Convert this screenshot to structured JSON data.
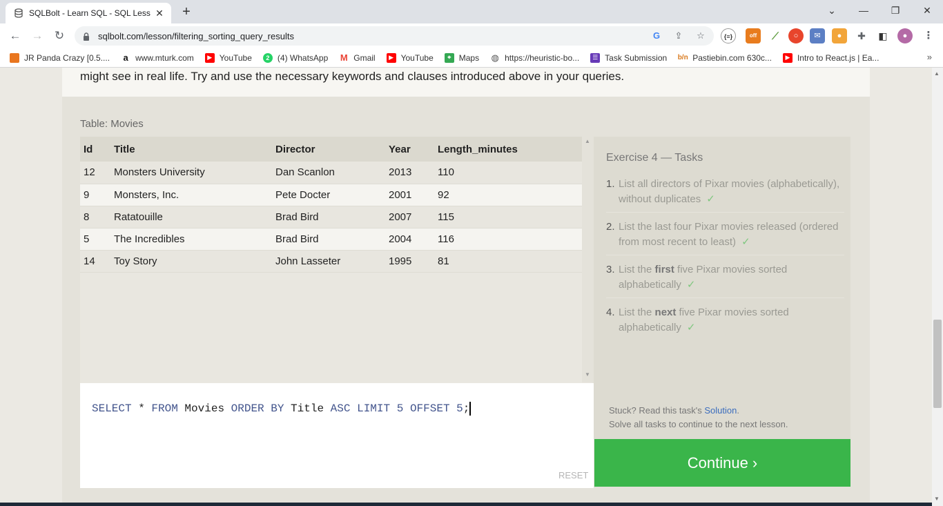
{
  "browser": {
    "tab_title": "SQLBolt - Learn SQL - SQL Lesso",
    "url": "sqlbolt.com/lesson/filtering_sorting_query_results",
    "bookmarks": [
      {
        "label": "JR Panda Crazy [0.5....",
        "icon": "panda-icon",
        "color": "#e9761f"
      },
      {
        "label": "www.mturk.com",
        "icon": "amazon-icon",
        "color": "#111111"
      },
      {
        "label": "YouTube",
        "icon": "youtube-icon",
        "color": "#ff0000"
      },
      {
        "label": "(4) WhatsApp",
        "icon": "whatsapp-icon",
        "color": "#25d366"
      },
      {
        "label": "Gmail",
        "icon": "gmail-icon",
        "color": "#ea4335"
      },
      {
        "label": "YouTube",
        "icon": "youtube-icon",
        "color": "#ff0000"
      },
      {
        "label": "Maps",
        "icon": "maps-icon",
        "color": "#34a853"
      },
      {
        "label": "https://heuristic-bo...",
        "icon": "globe-icon",
        "color": "#555555"
      },
      {
        "label": "Task Submission",
        "icon": "forms-icon",
        "color": "#673ab7"
      },
      {
        "label": "Pastiebin.com 630c...",
        "icon": "pastebin-icon",
        "color": "#d97a1e"
      },
      {
        "label": "Intro to React.js | Ea...",
        "icon": "youtube-icon",
        "color": "#ff0000"
      }
    ],
    "bookmarks_more": "»"
  },
  "page": {
    "intro_text": "might see in real life. Try and use the necessary keywords and clauses introduced above in your queries.",
    "table_caption": "Table: Movies",
    "table": {
      "headers": [
        "Id",
        "Title",
        "Director",
        "Year",
        "Length_minutes"
      ],
      "rows": [
        [
          "12",
          "Monsters University",
          "Dan Scanlon",
          "2013",
          "110"
        ],
        [
          "9",
          "Monsters, Inc.",
          "Pete Docter",
          "2001",
          "92"
        ],
        [
          "8",
          "Ratatouille",
          "Brad Bird",
          "2007",
          "115"
        ],
        [
          "5",
          "The Incredibles",
          "Brad Bird",
          "2004",
          "116"
        ],
        [
          "14",
          "Toy Story",
          "John Lasseter",
          "1995",
          "81"
        ]
      ]
    },
    "editor": {
      "tokens": [
        {
          "t": "SELECT",
          "c": "kw"
        },
        {
          "t": " * ",
          "c": "ident"
        },
        {
          "t": "FROM",
          "c": "kw"
        },
        {
          "t": " Movies ",
          "c": "ident"
        },
        {
          "t": "ORDER BY",
          "c": "kw"
        },
        {
          "t": " Title ",
          "c": "ident"
        },
        {
          "t": "ASC",
          "c": "kw"
        },
        {
          "t": " ",
          "c": "ident"
        },
        {
          "t": "LIMIT",
          "c": "kw"
        },
        {
          "t": " ",
          "c": "ident"
        },
        {
          "t": "5",
          "c": "num"
        },
        {
          "t": " ",
          "c": "ident"
        },
        {
          "t": "OFFSET",
          "c": "kw"
        },
        {
          "t": " ",
          "c": "ident"
        },
        {
          "t": "5",
          "c": "num"
        },
        {
          "t": ";",
          "c": "ident"
        }
      ],
      "reset_label": "RESET"
    },
    "tasks": {
      "title": "Exercise 4 — Tasks",
      "items": [
        {
          "num": "1.",
          "parts": [
            {
              "t": "List all directors of Pixar movies (alphabetically), without duplicates",
              "b": false
            }
          ],
          "check": "✓"
        },
        {
          "num": "2.",
          "parts": [
            {
              "t": "List the last four Pixar movies released (ordered from most recent to least)",
              "b": false
            }
          ],
          "check": "✓"
        },
        {
          "num": "3.",
          "parts": [
            {
              "t": "List the ",
              "b": false
            },
            {
              "t": "first",
              "b": true
            },
            {
              "t": " five Pixar movies sorted alphabetically",
              "b": false
            }
          ],
          "check": "✓"
        },
        {
          "num": "4.",
          "parts": [
            {
              "t": "List the ",
              "b": false
            },
            {
              "t": "next",
              "b": true
            },
            {
              "t": " five Pixar movies sorted alphabetically",
              "b": false
            }
          ],
          "check": "✓"
        }
      ],
      "stuck_prefix": "Stuck? Read this task's ",
      "solution_label": "Solution",
      "stuck_suffix": ".",
      "solve_all_text": "Solve all tasks to continue to the next lesson."
    },
    "continue_label": "Continue ›"
  }
}
